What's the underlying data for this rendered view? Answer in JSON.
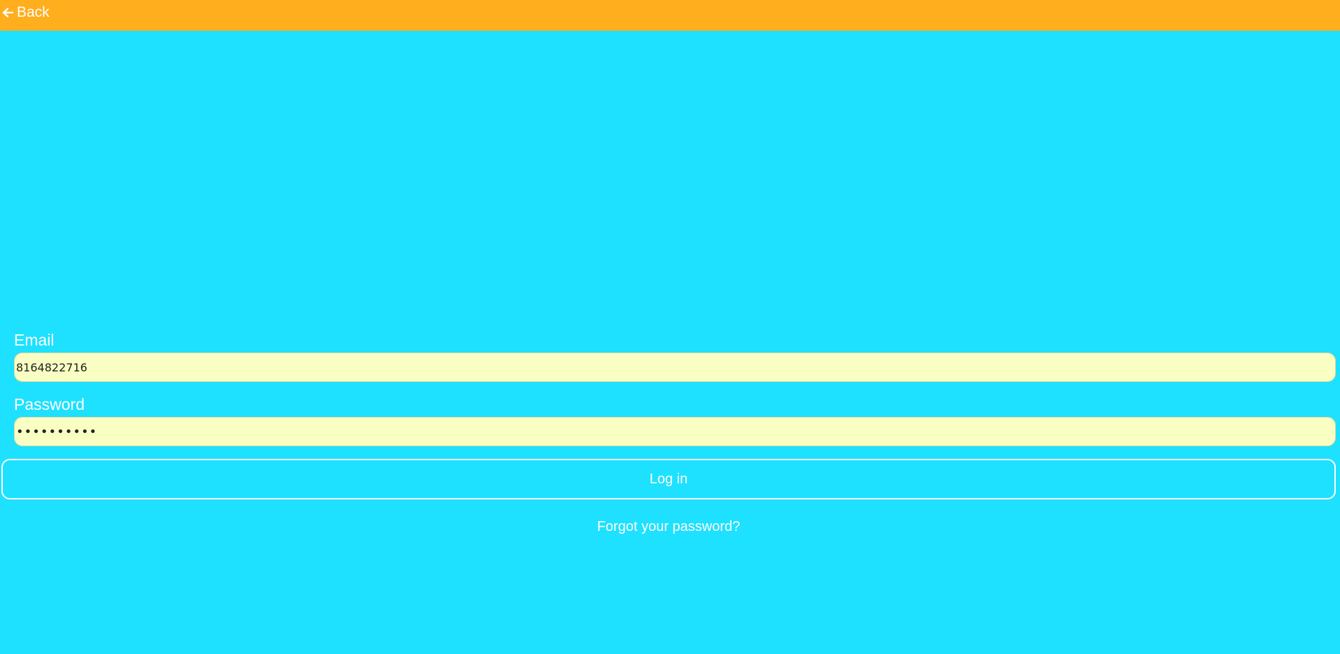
{
  "header": {
    "back_label": "Back",
    "back_icon": "arrow-left-icon"
  },
  "form": {
    "email_label": "Email",
    "email_value": "8164822716",
    "password_label": "Password",
    "password_value": "••••••••••",
    "login_label": "Log in",
    "forgot_label": "Forgot your password?"
  },
  "colors": {
    "background": "#1de1ff",
    "header_bar": "#ffae1e",
    "input_fill": "#f9fec2",
    "text": "#ffffff"
  }
}
